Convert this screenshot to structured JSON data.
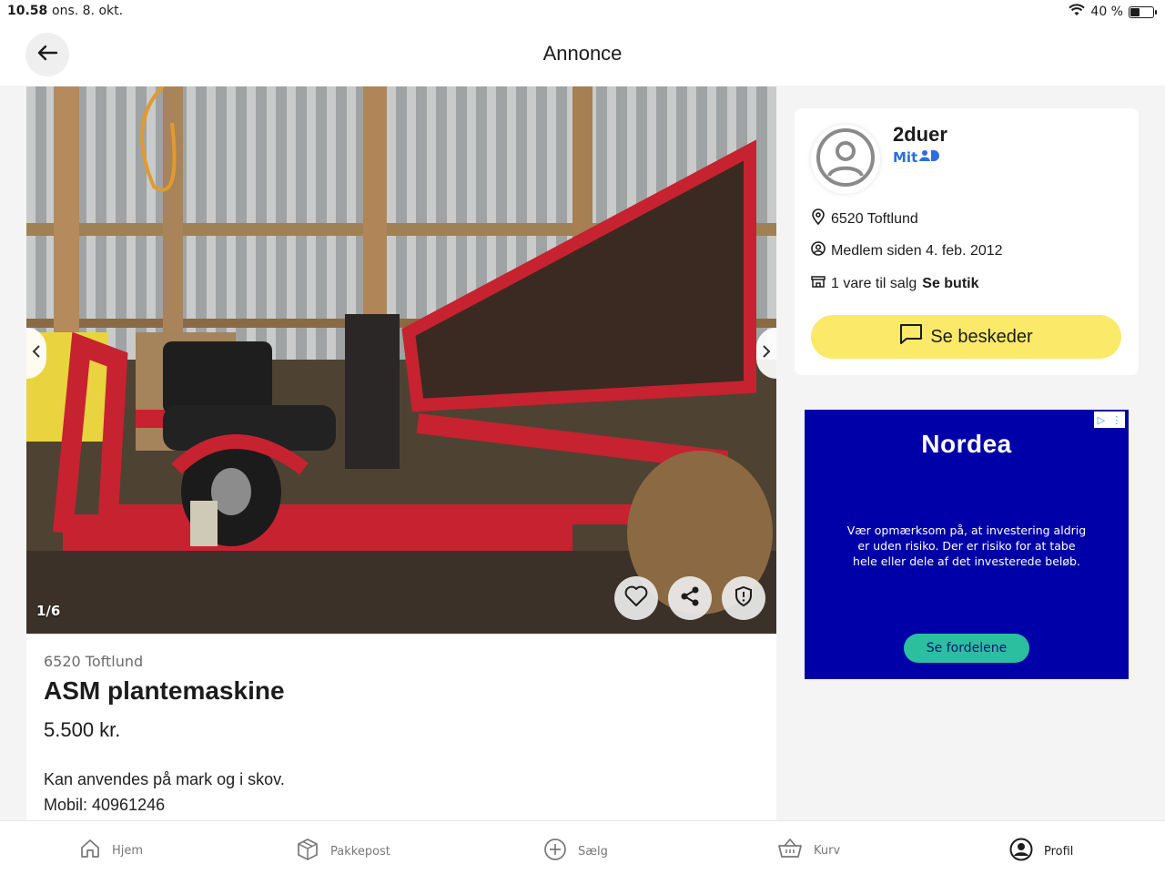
{
  "status": {
    "time": "10.58",
    "date": "ons. 8. okt.",
    "battery": "40 %"
  },
  "header": {
    "title": "Annonce"
  },
  "gallery": {
    "counter": "1/6"
  },
  "listing": {
    "location": "6520 Toftlund",
    "title": "ASM plantemaskine",
    "price": "5.500 kr.",
    "description": [
      "Kan anvendes på mark og i skov.",
      "Mobil: 40961246"
    ]
  },
  "seller": {
    "name": "2duer",
    "mitid": "Mit",
    "location": "6520 Toftlund",
    "member_since": "Medlem siden 4. feb. 2012",
    "items_for_sale": "1 vare til salg",
    "see_shop": "Se butik",
    "message_button": "Se beskeder"
  },
  "ad": {
    "brand": "Nordea",
    "text": "Vær opmærksom på, at investering aldrig er uden risiko. Der er risiko for at tabe hele eller dele af det investerede beløb.",
    "cta": "Se fordelene",
    "colors": {
      "background": "#0000a8",
      "cta": "#2bbfa0"
    }
  },
  "tabs": [
    {
      "label": "Hjem",
      "icon": "home-icon"
    },
    {
      "label": "Pakkepost",
      "icon": "package-icon"
    },
    {
      "label": "Sælg",
      "icon": "plus-circle-icon"
    },
    {
      "label": "Kurv",
      "icon": "basket-icon"
    },
    {
      "label": "Profil",
      "icon": "profile-icon",
      "active": true
    }
  ],
  "colors": {
    "accent_yellow": "#fbe96a",
    "mitid_blue": "#2a6ee0"
  }
}
